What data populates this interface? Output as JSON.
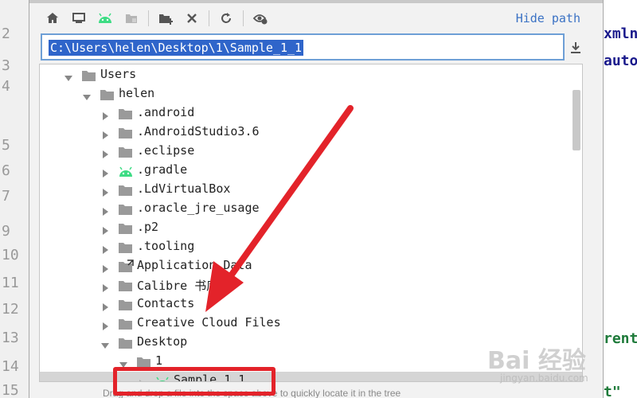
{
  "editor": {
    "line_numbers": [
      "2",
      "3",
      "4",
      "5",
      "6",
      "7",
      "9",
      "10",
      "11",
      "12",
      "13",
      "14",
      "15"
    ],
    "code_fragments": [
      "xmln",
      "auto'",
      "rent'",
      "t\""
    ]
  },
  "dialog": {
    "toolbar": {
      "buttons": [
        "home-icon",
        "desktop-icon",
        "android-icon",
        "module-icon",
        "new-folder-icon",
        "delete-icon",
        "refresh-icon",
        "show-hidden-icon"
      ],
      "hide_path_label": "Hide path"
    },
    "path": {
      "value": "C:\\Users\\helen\\Desktop\\1\\Sample_1_1"
    },
    "tree": {
      "rows": [
        {
          "label": "Users",
          "expanded": true,
          "icon": "folder-icon"
        },
        {
          "label": "helen",
          "expanded": true,
          "icon": "folder-icon"
        },
        {
          "label": ".android",
          "expanded": false,
          "icon": "folder-icon"
        },
        {
          "label": ".AndroidStudio3.6",
          "expanded": false,
          "icon": "folder-icon"
        },
        {
          "label": ".eclipse",
          "expanded": false,
          "icon": "folder-icon"
        },
        {
          "label": ".gradle",
          "expanded": false,
          "icon": "android-icon"
        },
        {
          "label": ".LdVirtualBox",
          "expanded": false,
          "icon": "folder-icon"
        },
        {
          "label": ".oracle_jre_usage",
          "expanded": false,
          "icon": "folder-icon"
        },
        {
          "label": ".p2",
          "expanded": false,
          "icon": "folder-icon"
        },
        {
          "label": ".tooling",
          "expanded": false,
          "icon": "folder-icon"
        },
        {
          "label": "Application Data",
          "expanded": false,
          "icon": "folder-link-icon"
        },
        {
          "label": "Calibre 书库",
          "expanded": false,
          "icon": "folder-icon"
        },
        {
          "label": "Contacts",
          "expanded": false,
          "icon": "folder-icon"
        },
        {
          "label": "Creative Cloud Files",
          "expanded": false,
          "icon": "folder-icon"
        },
        {
          "label": "Desktop",
          "expanded": true,
          "icon": "folder-icon"
        },
        {
          "label": "1",
          "expanded": true,
          "icon": "folder-icon"
        },
        {
          "label": "Sample_1_1",
          "expanded": false,
          "icon": "android-icon",
          "selected": true
        }
      ]
    },
    "footer_hint": "Drag and drop a file into the space above to quickly locate it in the tree"
  },
  "annotations": {
    "arrow_color": "#e3232a",
    "highlight_color": "#e3232a"
  },
  "watermark": {
    "main": "Bai 经验",
    "sub": "jingyan.baidu.com"
  },
  "colors": {
    "selection_blue": "#2f65ca",
    "link_blue": "#3b72c4",
    "android_green": "#3ddc84",
    "folder_gray": "#9a9a9a"
  }
}
